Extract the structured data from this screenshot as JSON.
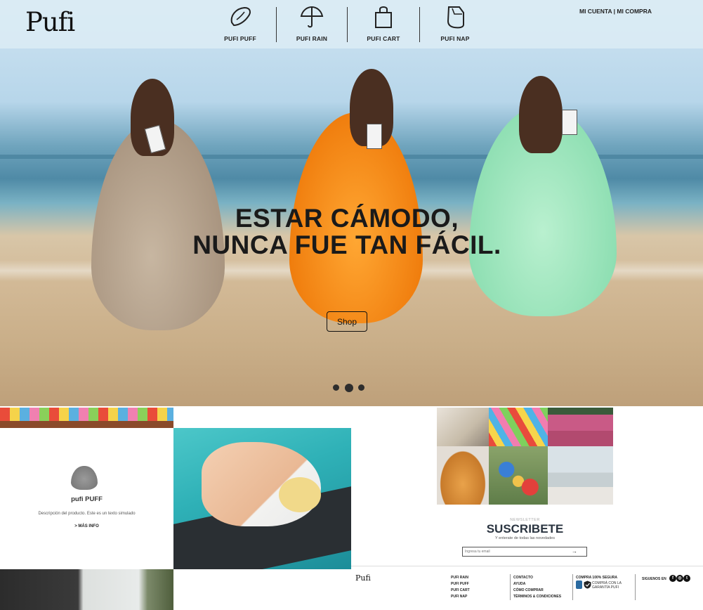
{
  "brand": {
    "logo": "Pufi"
  },
  "nav": {
    "items": [
      {
        "label": "PUFI PUFF",
        "icon": "bean-bag-icon"
      },
      {
        "label": "PUFI RAIN",
        "icon": "umbrella-icon"
      },
      {
        "label": "PUFI CART",
        "icon": "shopping-bag-icon"
      },
      {
        "label": "PUFI NAP",
        "icon": "nap-bag-icon"
      }
    ],
    "account": "MI CUENTA",
    "separator": " | ",
    "purchase": "MI COMPRA"
  },
  "hero": {
    "headline_line1": "ESTAR CÁMODO,",
    "headline_line2": "NUNCA FUE TAN FÁCIL.",
    "cta": "Shop",
    "slides_count": 3,
    "active_slide": 2
  },
  "product": {
    "name": "pufi PUFF",
    "description": "Descripción del producto. Este es un texto simulado",
    "link": "> MÁS INFO"
  },
  "newsletter": {
    "eyebrow": "NEWSLETTER",
    "title": "SUSCRIBETE",
    "subtitle": "Y enterate de todas las novedades",
    "placeholder": "Ingresa tu email",
    "submit": "→"
  },
  "footer": {
    "logo": "Pufi",
    "products": [
      "PUFI RAIN",
      "PUFI PUFF",
      "PUFI CART",
      "PUFI NAP"
    ],
    "help": [
      "CONTACTO",
      "AYUDA",
      "CÓMO COMPRAR",
      "TÉRMINOS & CONDICIONES"
    ],
    "secure_title": "COMPRA 100% SEGURA",
    "secure_text": "COMPRÁ CON LA GARANTÍA PUFI",
    "follow": "SIGUENOS EN",
    "social": [
      "facebook-icon",
      "instagram-icon",
      "twitter-icon"
    ]
  },
  "colors": {
    "accent": "#2a3440",
    "topbar": "#dcecf5",
    "text": "#222222"
  }
}
